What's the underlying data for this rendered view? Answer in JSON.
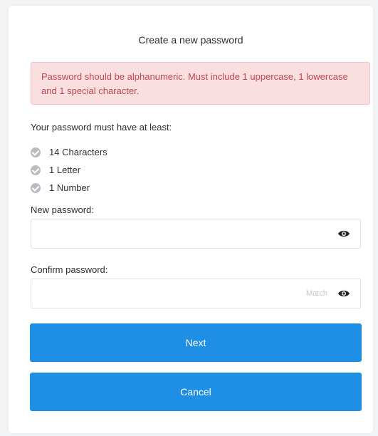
{
  "form": {
    "title": "Create a new password",
    "error_message": "Password should be alphanumeric. Must include 1 uppercase, 1 lowercase and 1 special character.",
    "requirements_title": "Your password must have at least:",
    "requirements": [
      {
        "label": "14 Characters",
        "icon": "check-circle-icon"
      },
      {
        "label": "1 Letter",
        "icon": "check-circle-icon"
      },
      {
        "label": "1 Number",
        "icon": "check-circle-icon"
      }
    ],
    "new_password": {
      "label": "New password:",
      "value": "",
      "placeholder": "",
      "icon": "eye-icon"
    },
    "confirm_password": {
      "label": "Confirm password:",
      "value": "",
      "placeholder": "",
      "hint": "Match",
      "icon": "eye-icon"
    },
    "next_label": "Next",
    "cancel_label": "Cancel"
  },
  "colors": {
    "primary_button": "#1f8fe6",
    "error_bg": "#f9dfe0",
    "error_text": "#c0464f",
    "check_gray": "#b9bcc1"
  }
}
